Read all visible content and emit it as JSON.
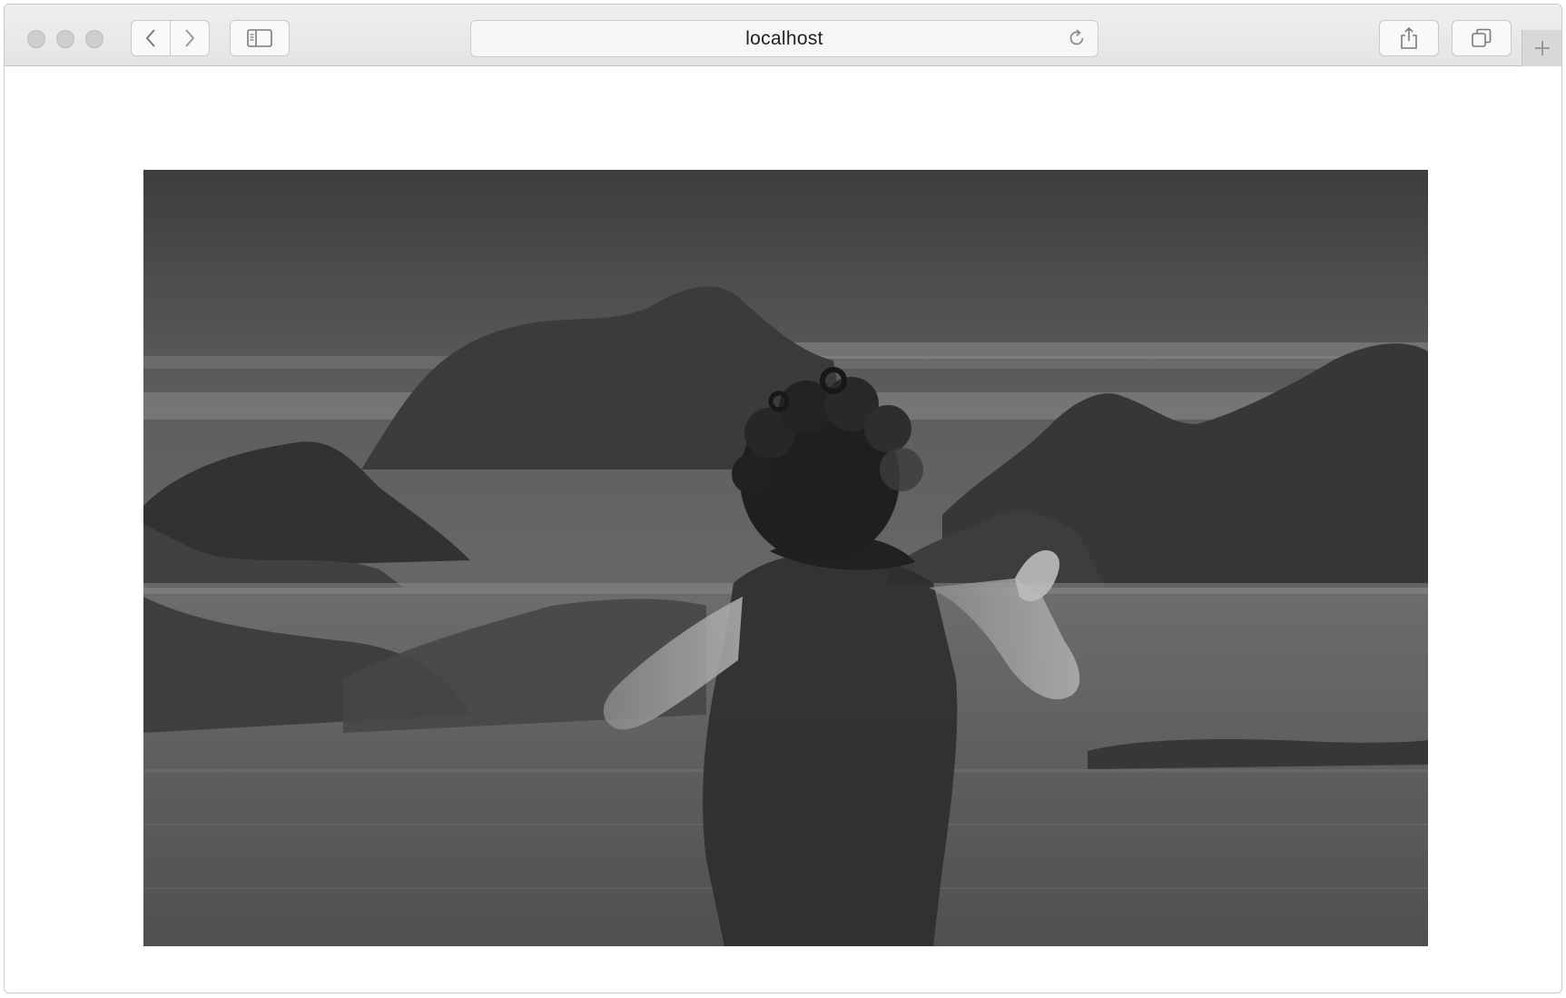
{
  "browser": {
    "address": "localhost",
    "icons": {
      "back": "chevron-left-icon",
      "forward": "chevron-right-icon",
      "sidebar": "sidebar-icon",
      "reload": "reload-icon",
      "share": "share-icon",
      "tabs": "tabs-overview-icon",
      "new_tab": "plus-icon"
    }
  },
  "page": {
    "image": {
      "subject": "child-on-rocky-beach-double-exposure",
      "style": "grayscale"
    }
  }
}
